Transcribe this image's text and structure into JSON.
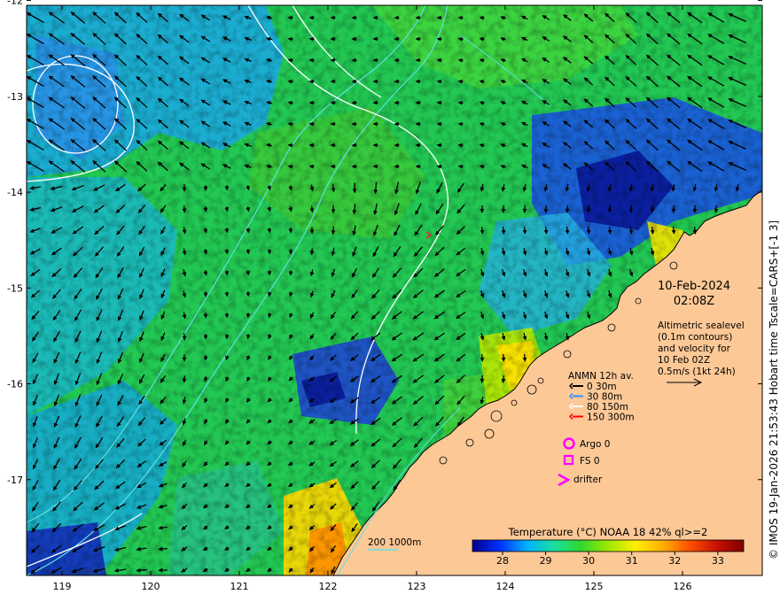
{
  "map": {
    "date": "10-Feb-2024",
    "time": "02:08Z",
    "altimetry_note": [
      "Altimetric sealevel",
      "(0.1m contours)",
      "and velocity for",
      "10 Feb 02Z",
      "0.5m/s (1kt 24h)"
    ],
    "anmn_title": "ANMN 12h av.",
    "anmn_legend": [
      {
        "label": "0 30m",
        "color": "#000000"
      },
      {
        "label": "30 80m",
        "color": "#2f8fff"
      },
      {
        "label": "80 150m",
        "color": "#ffffff"
      },
      {
        "label": "150 300m",
        "color": "#ff0000"
      }
    ],
    "argo_label": "Argo 0",
    "fs_label": "FS 0",
    "drifter_label": "drifter",
    "marker_color": "#ff00ff",
    "depth_legend": "200  1000m",
    "colorbar_title": "Temperature (°C) NOAA 18 42% ql>=2",
    "colorbar_ticks": [
      "28",
      "29",
      "30",
      "31",
      "32",
      "33"
    ],
    "colorbar_range": [
      27.3,
      33.6
    ],
    "colorbar_colors": [
      "#00008f",
      "#0030ff",
      "#00b0ff",
      "#1adfa0",
      "#2ed82e",
      "#9fe800",
      "#ffee00",
      "#ffb000",
      "#ff5000",
      "#c81000",
      "#800000"
    ],
    "lon_ticks": [
      "119",
      "120",
      "121",
      "122",
      "123",
      "124",
      "125",
      "126"
    ],
    "lat_ticks": [
      "-12",
      "-13",
      "-14",
      "-15",
      "-16",
      "-17"
    ],
    "lon_range": [
      118.6,
      126.9
    ],
    "lat_range": [
      -12.05,
      -18.0
    ],
    "land_color": "#fcc896",
    "credit": "© IMOS 19-Jan-2026 21:53:43 Hobart time Tscale=CARS+[-1 3]"
  }
}
